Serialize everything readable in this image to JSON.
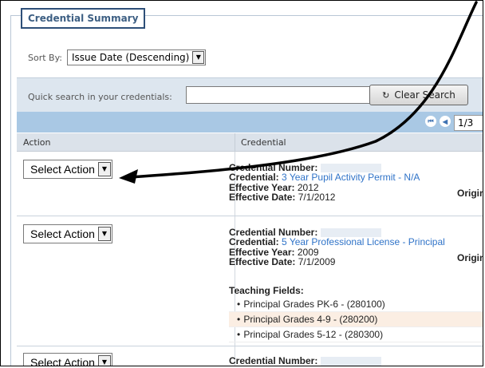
{
  "panel": {
    "title": "Credential Summary"
  },
  "sort": {
    "label": "Sort By:",
    "value": "Issue Date (Descending)"
  },
  "search": {
    "label": "Quick search in your credentials:",
    "value": "",
    "clear_label": "Clear Search",
    "clear_icon": "refresh-icon"
  },
  "pager": {
    "page_text": "1/3",
    "first_icon": "first-page-icon",
    "prev_icon": "prev-page-icon"
  },
  "table": {
    "headers": [
      "Action",
      "Credential"
    ],
    "rows": [
      {
        "action": "Select Action",
        "number_label": "Credential Number:",
        "credential_label": "Credential:",
        "credential_value": "3 Year Pupil Activity Permit - N/A",
        "year_label": "Effective Year:",
        "year_value": "2012",
        "date_label": "Effective Date:",
        "date_value": "7/1/2012",
        "orig_label": "Origin"
      },
      {
        "action": "Select Action",
        "number_label": "Credential Number:",
        "credential_label": "Credential:",
        "credential_value": "5 Year Professional License - Principal",
        "year_label": "Effective Year:",
        "year_value": "2009",
        "date_label": "Effective Date:",
        "date_value": "7/1/2009",
        "orig_label": "Origin",
        "teaching_label": "Teaching Fields:",
        "teaching_fields": [
          "Principal Grades PK-6 - (280100)",
          "Principal Grades 4-9 - (280200)",
          "Principal Grades 5-12 - (280300)"
        ]
      },
      {
        "action": "Select Action",
        "number_label": "Credential Number:"
      }
    ]
  },
  "colors": {
    "header_bar": "#a9c8e4",
    "link": "#2f73c8",
    "panel_border": "#2e4f78"
  }
}
